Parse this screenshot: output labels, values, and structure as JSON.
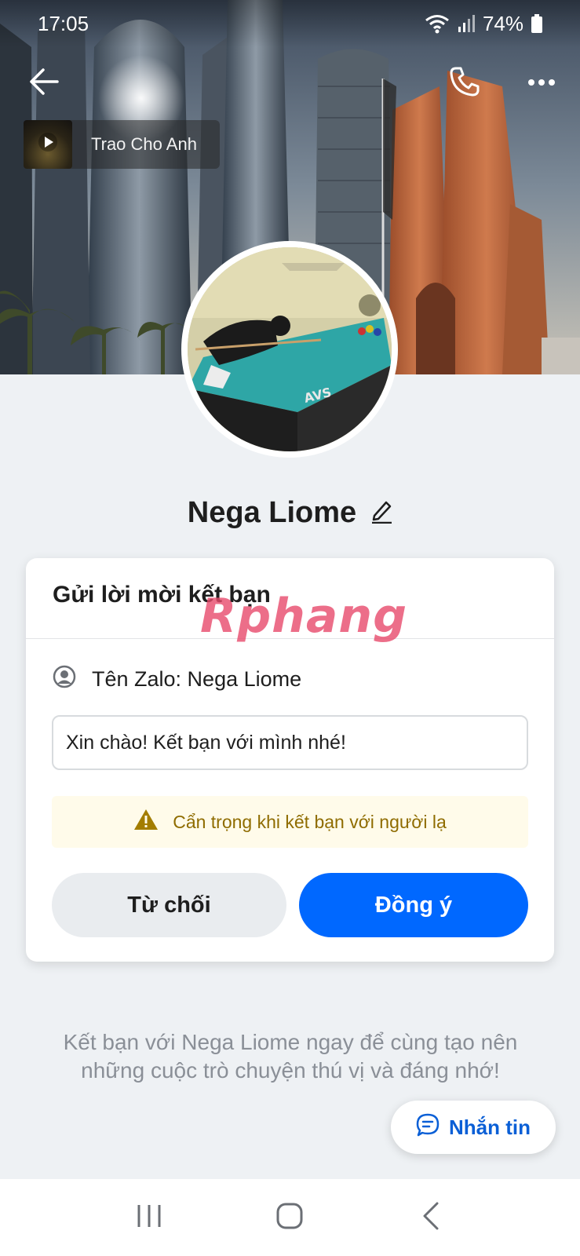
{
  "status_bar": {
    "time": "17:05",
    "battery": "74%"
  },
  "music": {
    "song_title": "Trao Cho Anh"
  },
  "profile": {
    "name": "Nega Liome"
  },
  "friend_request": {
    "title": "Gửi lời mời kết bạn",
    "zalo_name": "Tên Zalo: Nega Liome",
    "message_value": "Xin chào! Kết bạn với mình nhé!",
    "warning": "Cẩn trọng khi kết bạn với người lạ",
    "decline_label": "Từ chối",
    "accept_label": "Đồng ý"
  },
  "watermark": "Rphang",
  "footer": {
    "description": "Kết bạn với Nega Liome ngay để cùng tạo nên những cuộc trò chuyện thú vị và đáng nhớ!"
  },
  "chat_button": {
    "label": "Nhắn tin"
  },
  "colors": {
    "accent": "#0068ff",
    "warning_text": "#8f6c00",
    "warning_bg": "#fffbea",
    "background": "#eef1f4"
  },
  "icons": [
    "back-arrow-icon",
    "phone-icon",
    "more-icon",
    "play-icon",
    "edit-pencil-icon",
    "user-circle-icon",
    "warning-icon",
    "chat-bubble-icon",
    "recent-apps-icon",
    "home-icon",
    "back-nav-icon",
    "wifi-icon",
    "signal-icon",
    "battery-icon"
  ]
}
